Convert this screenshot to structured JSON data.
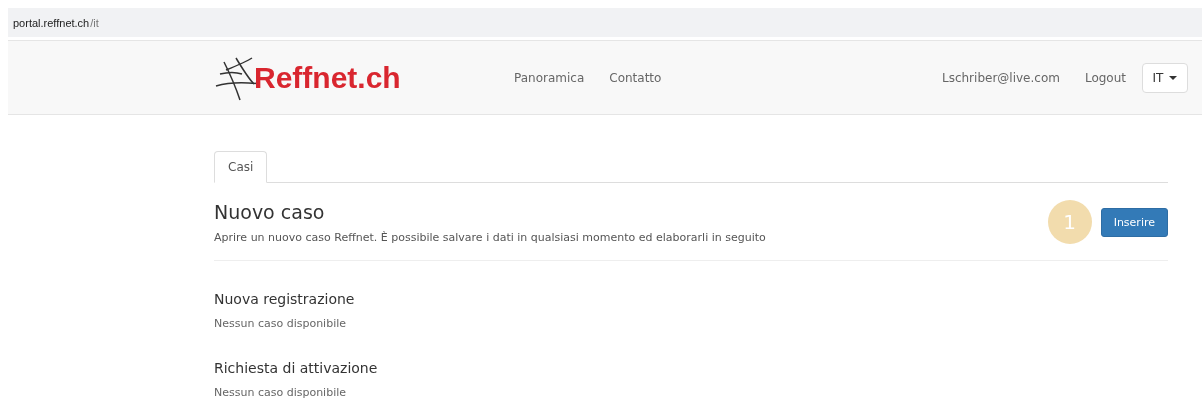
{
  "address_bar": {
    "host": "portal.reffnet.ch",
    "path": "/it"
  },
  "navbar": {
    "logo": "Reffnet.ch",
    "links": [
      "Panoramica",
      "Contatto"
    ],
    "user": "Lschriber@live.com",
    "logout": "Logout",
    "language": "IT"
  },
  "tabs": [
    {
      "label": "Casi",
      "selected": true
    }
  ],
  "new_case": {
    "title": "Nuovo caso",
    "description": "Aprire un nuovo caso Reffnet. È possibile salvare i dati in qualsiasi momento ed elaborarli in seguito",
    "step_badge": "1",
    "button": "Inserire"
  },
  "sections": [
    {
      "title": "Nuova registrazione",
      "text": "Nessun caso disponibile"
    },
    {
      "title": "Richiesta di attivazione",
      "text": "Nessun caso disponibile"
    }
  ]
}
